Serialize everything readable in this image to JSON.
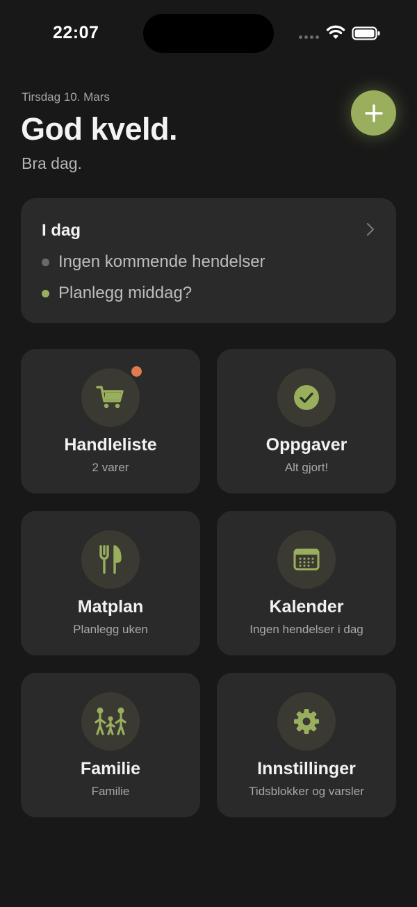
{
  "status_bar": {
    "time": "22:07"
  },
  "header": {
    "date": "Tirsdag 10. Mars",
    "greeting": "God kveld.",
    "subtitle": "Bra dag.",
    "add_icon": "plus-icon"
  },
  "today": {
    "title": "I dag",
    "items": [
      {
        "text": "Ingen kommende hendelser",
        "dot_color": "#6a6a6a"
      },
      {
        "text": "Planlegg middag?",
        "dot_color": "#9aaf5e"
      }
    ]
  },
  "tiles": [
    {
      "title": "Handleliste",
      "subtitle": "2 varer",
      "icon": "shopping-cart-icon",
      "has_badge": true
    },
    {
      "title": "Oppgaver",
      "subtitle": "Alt gjort!",
      "icon": "checkmark-circle-icon"
    },
    {
      "title": "Matplan",
      "subtitle": "Planlegg uken",
      "icon": "fork-knife-icon"
    },
    {
      "title": "Kalender",
      "subtitle": "Ingen hendelser i dag",
      "icon": "calendar-icon"
    },
    {
      "title": "Familie",
      "subtitle": "Familie",
      "icon": "family-icon"
    },
    {
      "title": "Innstillinger",
      "subtitle": "Tidsblokker og varsler",
      "icon": "gear-icon"
    }
  ],
  "colors": {
    "background": "#181818",
    "card": "#2a2a2a",
    "accent": "#9aaf5e",
    "icon_circle": "#3a3a32",
    "badge": "#e07a4f"
  }
}
